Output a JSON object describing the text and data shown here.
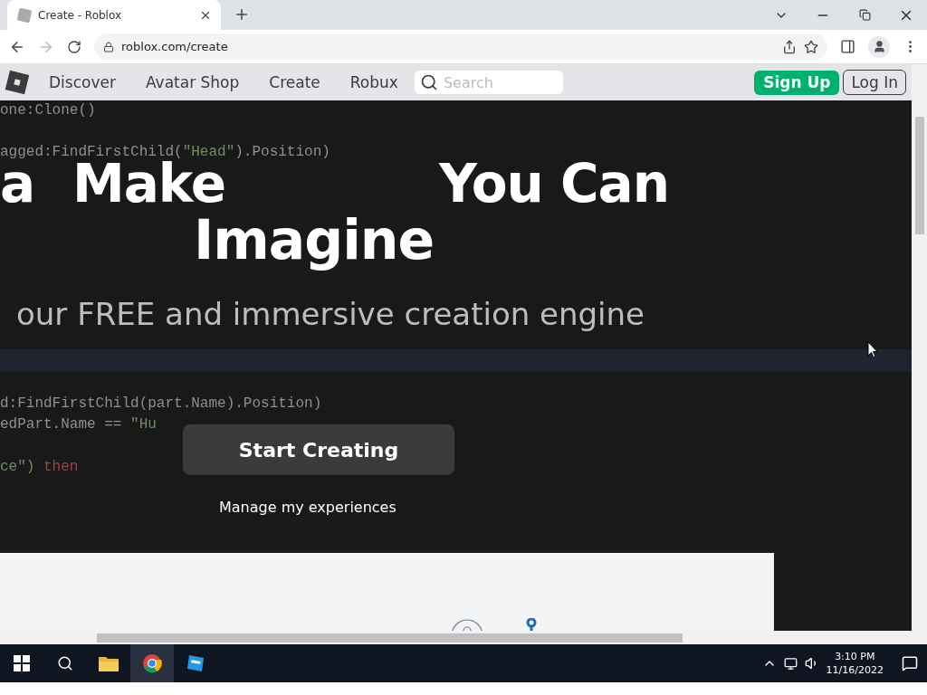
{
  "browser": {
    "tab_title": "Create - Roblox",
    "address": "roblox.com/create",
    "forward_disabled": true
  },
  "nav": {
    "links": [
      "Discover",
      "Avatar Shop",
      "Create",
      "Robux"
    ],
    "search": {
      "placeholder": "Search"
    },
    "sign_up": "Sign Up",
    "log_in": "Log In"
  },
  "hero": {
    "code_top": [
      [
        {
          "text": "one:Clone()",
          "kind": "plain"
        }
      ],
      [
        {
          "text": "agged:FindFirstChild(",
          "kind": "plain"
        },
        {
          "text": "\"Head\"",
          "kind": "string"
        },
        {
          "text": ").Position)",
          "kind": "plain"
        }
      ]
    ],
    "headline": {
      "fragments": [
        "a",
        "Make",
        "You Can"
      ],
      "second_line": "Imagine"
    },
    "subtitle": "our FREE and immersive creation engine",
    "code_bottom": [
      [
        {
          "text": "d:FindFirstChild(part.Name).Position)",
          "kind": "plain"
        }
      ],
      [
        {
          "text": "edPart.Name == ",
          "kind": "plain"
        },
        {
          "text": "\"Hu",
          "kind": "string"
        }
      ],
      [
        {
          "text": "ce\")",
          "kind": "string"
        },
        {
          "text": " then",
          "kind": "keyword"
        }
      ]
    ],
    "primary_button": "Start Creating",
    "secondary_link": "Manage my experiences"
  },
  "taskbar": {
    "time": "3:10 PM",
    "date": "11/16/2022"
  }
}
